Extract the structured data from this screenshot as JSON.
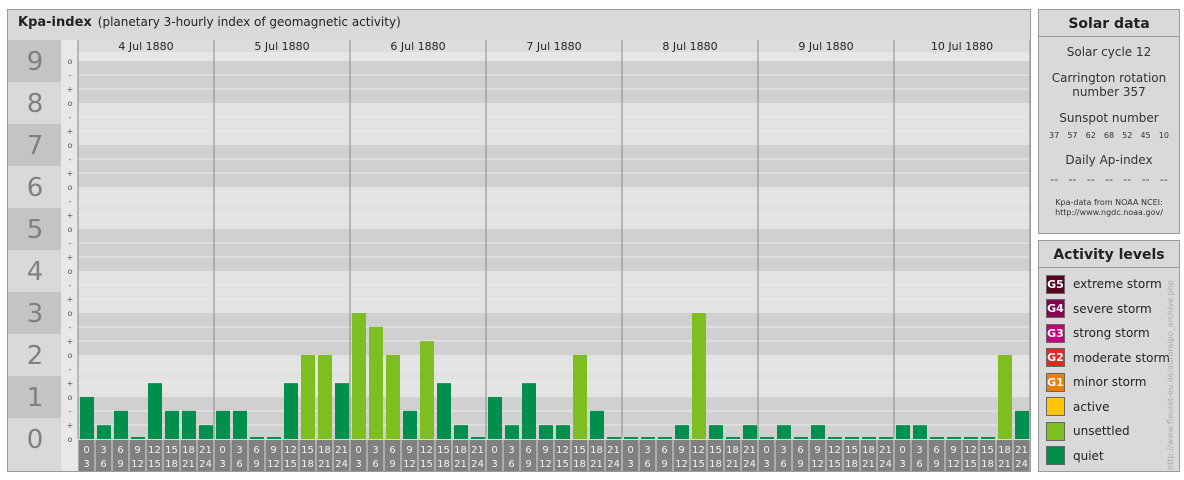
{
  "title": {
    "name": "Kpa-index",
    "subtitle": "(planetary 3-hourly index of geomagnetic activity)"
  },
  "chart_data": {
    "type": "bar",
    "title": "Kpa-index",
    "subtitle": "(planetary 3-hourly index of geomagnetic activity)",
    "ylim": [
      0,
      9
    ],
    "y_ticks": [
      "0",
      "1",
      "2",
      "3",
      "4",
      "5",
      "6",
      "7",
      "8",
      "9"
    ],
    "subdivision_labels": [
      "o",
      "+",
      "-",
      "o",
      "+",
      "-",
      "o",
      "+",
      "-",
      "o",
      "+",
      "-",
      "o",
      "+",
      "-",
      "o",
      "+",
      "-",
      "o",
      "+",
      "-",
      "o",
      "+",
      "-",
      "o",
      "+",
      "-",
      "o"
    ],
    "days": [
      "4 Jul 1880",
      "5 Jul 1880",
      "6 Jul 1880",
      "7 Jul 1880",
      "8 Jul 1880",
      "9 Jul 1880",
      "10 Jul 1880"
    ],
    "interval_start_hours": [
      "0",
      "3",
      "6",
      "9",
      "12",
      "15",
      "18",
      "21"
    ],
    "interval_end_hours": [
      "3",
      "6",
      "9",
      "12",
      "15",
      "18",
      "21",
      "24"
    ],
    "values": [
      [
        1.0,
        0.33,
        0.67,
        0,
        1.33,
        0.67,
        0.67,
        0.33
      ],
      [
        0.67,
        0.67,
        0,
        0,
        1.33,
        2.0,
        2.0,
        1.33
      ],
      [
        3.0,
        2.67,
        2.0,
        0.67,
        2.33,
        1.33,
        0.33,
        0
      ],
      [
        1.0,
        0.33,
        1.33,
        0.33,
        0.33,
        2.0,
        0.67,
        0
      ],
      [
        0,
        0,
        0,
        0.33,
        3.0,
        0.33,
        0,
        0.33
      ],
      [
        0,
        0.33,
        0,
        0.33,
        0,
        0,
        0,
        0
      ],
      [
        0.33,
        0.33,
        0,
        0,
        0,
        0,
        2.0,
        0.67
      ]
    ],
    "level_colors": {
      "quiet": "#008f4c",
      "unsettled": "#7dbf21"
    }
  },
  "solar": {
    "heading": "Solar data",
    "cycle": "Solar cycle 12",
    "carrington_1": "Carrington rotation",
    "carrington_2": "number 357",
    "sunspot_heading": "Sunspot number",
    "sunspots": [
      "37",
      "57",
      "62",
      "68",
      "52",
      "45",
      "10"
    ],
    "ap_heading": "Daily Ap-index",
    "ap_values": [
      "--",
      "--",
      "--",
      "--",
      "--",
      "--",
      "--"
    ],
    "credit_1": "Kpa-data from NOAA NCEI:",
    "credit_2": "http://www.ngdc.noaa.gov/"
  },
  "levels": {
    "heading": "Activity levels",
    "items": [
      {
        "badge": "G5",
        "label": "extreme storm",
        "color": "#5a0027"
      },
      {
        "badge": "G4",
        "label": "severe storm",
        "color": "#8a0050"
      },
      {
        "badge": "G3",
        "label": "strong storm",
        "color": "#c4007a"
      },
      {
        "badge": "G2",
        "label": "moderate storm",
        "color": "#e0291f"
      },
      {
        "badge": "G1",
        "label": "minor storm",
        "color": "#ef7d00"
      },
      {
        "badge": "",
        "label": "active",
        "color": "#ffc400"
      },
      {
        "badge": "",
        "label": "unsettled",
        "color": "#7dbf21"
      },
      {
        "badge": "",
        "label": "quiet",
        "color": "#008f4c"
      }
    ]
  },
  "watermark": "http://www.fleuret-eu.de/auroralpo_archive.php"
}
